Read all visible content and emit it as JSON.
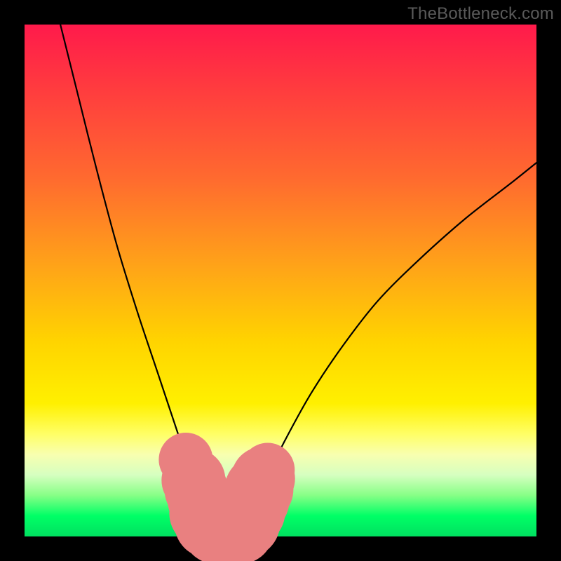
{
  "watermark": "TheBottleneck.com",
  "chart_data": {
    "type": "line",
    "title": "",
    "xlabel": "",
    "ylabel": "",
    "xlim": [
      0,
      100
    ],
    "ylim": [
      0,
      100
    ],
    "grid": false,
    "legend": false,
    "series": [
      {
        "name": "left-curve",
        "x": [
          7,
          10,
          14,
          18,
          22,
          26,
          30,
          32,
          34,
          35.5,
          37
        ],
        "values": [
          100,
          88,
          72,
          57,
          44,
          32,
          20,
          14,
          8,
          4,
          1
        ]
      },
      {
        "name": "right-curve",
        "x": [
          42,
          44,
          47,
          51,
          56,
          62,
          69,
          77,
          86,
          95,
          100
        ],
        "values": [
          1,
          5,
          11,
          19,
          28,
          37,
          46,
          54,
          62,
          69,
          73
        ]
      }
    ],
    "markers": [
      {
        "name": "highlight-dots",
        "color": "#e98080",
        "points": [
          {
            "x": 31.5,
            "y": 15.0,
            "r": 2.2
          },
          {
            "x": 32.3,
            "y": 13.0,
            "r": 2.2
          },
          {
            "x": 33.0,
            "y": 11.0,
            "r": 2.6
          },
          {
            "x": 33.6,
            "y": 9.0,
            "r": 2.6
          },
          {
            "x": 34.2,
            "y": 7.0,
            "r": 2.6
          },
          {
            "x": 35.0,
            "y": 4.5,
            "r": 2.8
          },
          {
            "x": 36.0,
            "y": 2.5,
            "r": 2.8
          },
          {
            "x": 37.5,
            "y": 1.3,
            "r": 2.8
          },
          {
            "x": 39.0,
            "y": 1.0,
            "r": 2.8
          },
          {
            "x": 40.5,
            "y": 1.0,
            "r": 2.8
          },
          {
            "x": 42.0,
            "y": 1.3,
            "r": 2.8
          },
          {
            "x": 43.2,
            "y": 2.6,
            "r": 2.8
          },
          {
            "x": 44.2,
            "y": 4.8,
            "r": 2.8
          },
          {
            "x": 45.0,
            "y": 7.0,
            "r": 2.8
          },
          {
            "x": 45.8,
            "y": 9.2,
            "r": 2.8
          },
          {
            "x": 46.6,
            "y": 11.3,
            "r": 2.6
          },
          {
            "x": 47.5,
            "y": 13.0,
            "r": 2.2
          }
        ]
      }
    ]
  }
}
